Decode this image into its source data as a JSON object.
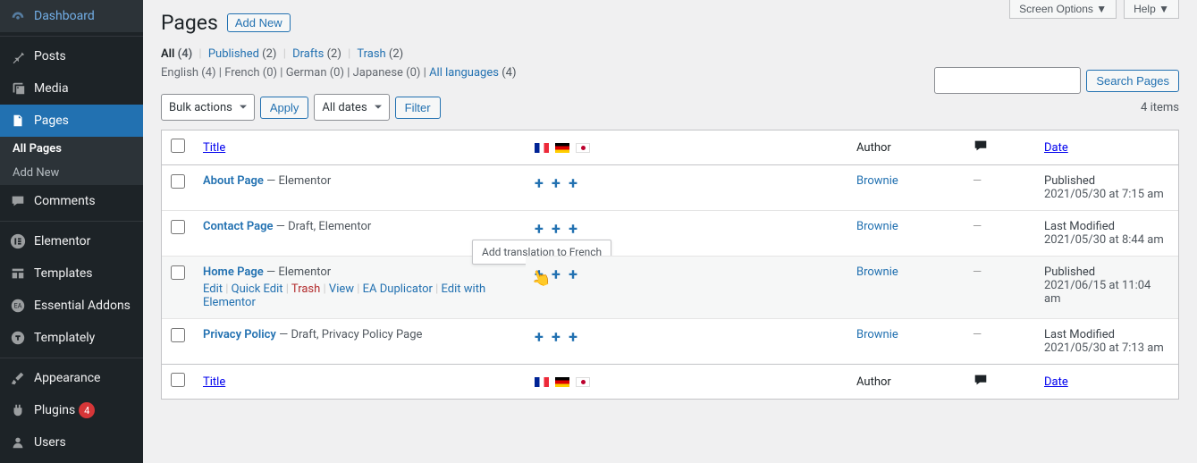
{
  "sidebar": {
    "items": [
      {
        "label": "Dashboard",
        "icon": "dashboard-icon"
      },
      {
        "label": "Posts",
        "icon": "pin-icon"
      },
      {
        "label": "Media",
        "icon": "media-icon"
      },
      {
        "label": "Pages",
        "icon": "page-icon"
      },
      {
        "label": "Comments",
        "icon": "comment-icon"
      },
      {
        "label": "Elementor",
        "icon": "elementor-icon"
      },
      {
        "label": "Templates",
        "icon": "templates-icon"
      },
      {
        "label": "Essential Addons",
        "icon": "ea-icon"
      },
      {
        "label": "Templately",
        "icon": "templately-icon"
      },
      {
        "label": "Appearance",
        "icon": "brush-icon"
      },
      {
        "label": "Plugins",
        "icon": "plugin-icon"
      },
      {
        "label": "Users",
        "icon": "user-icon"
      }
    ],
    "submenu": {
      "all_pages": "All Pages",
      "add_new": "Add New"
    },
    "plugins_badge": "4"
  },
  "top_tabs": {
    "screen_options": "Screen Options",
    "help": "Help"
  },
  "heading": {
    "title": "Pages",
    "add_new": "Add New"
  },
  "filters": {
    "all": "All",
    "all_count": "(4)",
    "published": "Published",
    "published_count": "(2)",
    "drafts": "Drafts",
    "drafts_count": "(2)",
    "trash": "Trash",
    "trash_count": "(2)"
  },
  "langs": {
    "english": "English (4)",
    "french": "French (0)",
    "german": "German (0)",
    "japanese": "Japanese (0)",
    "all_languages": "All languages",
    "all_languages_count": "(4)"
  },
  "controls": {
    "bulk_actions": "Bulk actions",
    "apply": "Apply",
    "all_dates": "All dates",
    "filter": "Filter",
    "search_pages": "Search Pages",
    "items_count": "4 items"
  },
  "table": {
    "columns": {
      "title": "Title",
      "author": "Author",
      "date": "Date"
    },
    "rows": [
      {
        "title": "About Page",
        "suffix": " — Elementor",
        "author": "Brownie",
        "comments": "—",
        "status": "Published",
        "time": "2021/05/30 at 7:15 am"
      },
      {
        "title": "Contact Page",
        "suffix": " — Draft, Elementor",
        "author": "Brownie",
        "comments": "—",
        "status": "Last Modified",
        "time": "2021/05/30 at 8:44 am"
      },
      {
        "title": "Home Page",
        "suffix": " — Elementor",
        "author": "Brownie",
        "comments": "—",
        "status": "Published",
        "time": "2021/06/15 at 11:04 am",
        "actions": {
          "edit": "Edit",
          "quick_edit": "Quick Edit",
          "trash": "Trash",
          "view": "View",
          "ea_dup": "EA Duplicator",
          "edit_elem": "Edit with Elementor"
        }
      },
      {
        "title": "Privacy Policy",
        "suffix": " — Draft, Privacy Policy Page",
        "author": "Brownie",
        "comments": "—",
        "status": "Last Modified",
        "time": "2021/05/30 at 7:13 am"
      }
    ]
  },
  "tooltip": "Add translation to French"
}
